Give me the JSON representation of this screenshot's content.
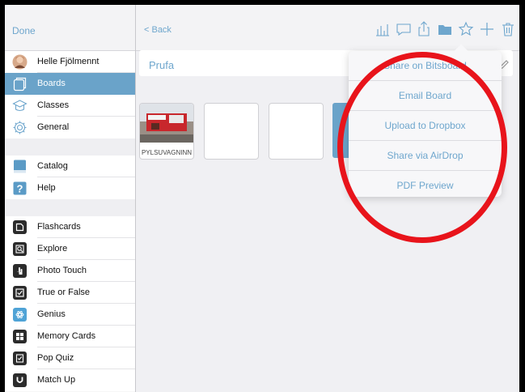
{
  "sidebar": {
    "done_label": "Done",
    "user": {
      "name": "Helle Fjölmennt",
      "icon": "user-avatar"
    },
    "items": [
      {
        "label": "Boards",
        "icon": "boards-icon",
        "active": true
      },
      {
        "label": "Classes",
        "icon": "classes-icon"
      },
      {
        "label": "General",
        "icon": "gear-icon"
      }
    ],
    "resources": [
      {
        "label": "Catalog",
        "icon": "book-icon"
      },
      {
        "label": "Help",
        "icon": "help-icon"
      }
    ],
    "activities": [
      {
        "label": "Flashcards",
        "icon": "flashcards-icon"
      },
      {
        "label": "Explore",
        "icon": "explore-icon"
      },
      {
        "label": "Photo Touch",
        "icon": "hand-icon"
      },
      {
        "label": "True or False",
        "icon": "checkbox-icon"
      },
      {
        "label": "Genius",
        "icon": "genius-icon"
      },
      {
        "label": "Memory Cards",
        "icon": "memory-cards-icon"
      },
      {
        "label": "Pop Quiz",
        "icon": "pop-quiz-icon"
      },
      {
        "label": "Match Up",
        "icon": "match-up-icon"
      }
    ]
  },
  "toolbar": {
    "back_label": "< Back",
    "icons": [
      "chart-icon",
      "chat-icon",
      "share-icon",
      "folder-icon",
      "star-icon",
      "plus-icon",
      "trash-icon"
    ]
  },
  "board": {
    "title": "Prufa",
    "tile_caption": "PYLSUVAGNINN"
  },
  "share_menu": {
    "items": [
      "Share on Bitsboard",
      "Email Board",
      "Upload to Dropbox",
      "Share via AirDrop",
      "PDF Preview"
    ]
  },
  "colors": {
    "accent": "#6ea6cd",
    "active_bg": "#6aa3c9",
    "annotation": "#e8141b"
  }
}
